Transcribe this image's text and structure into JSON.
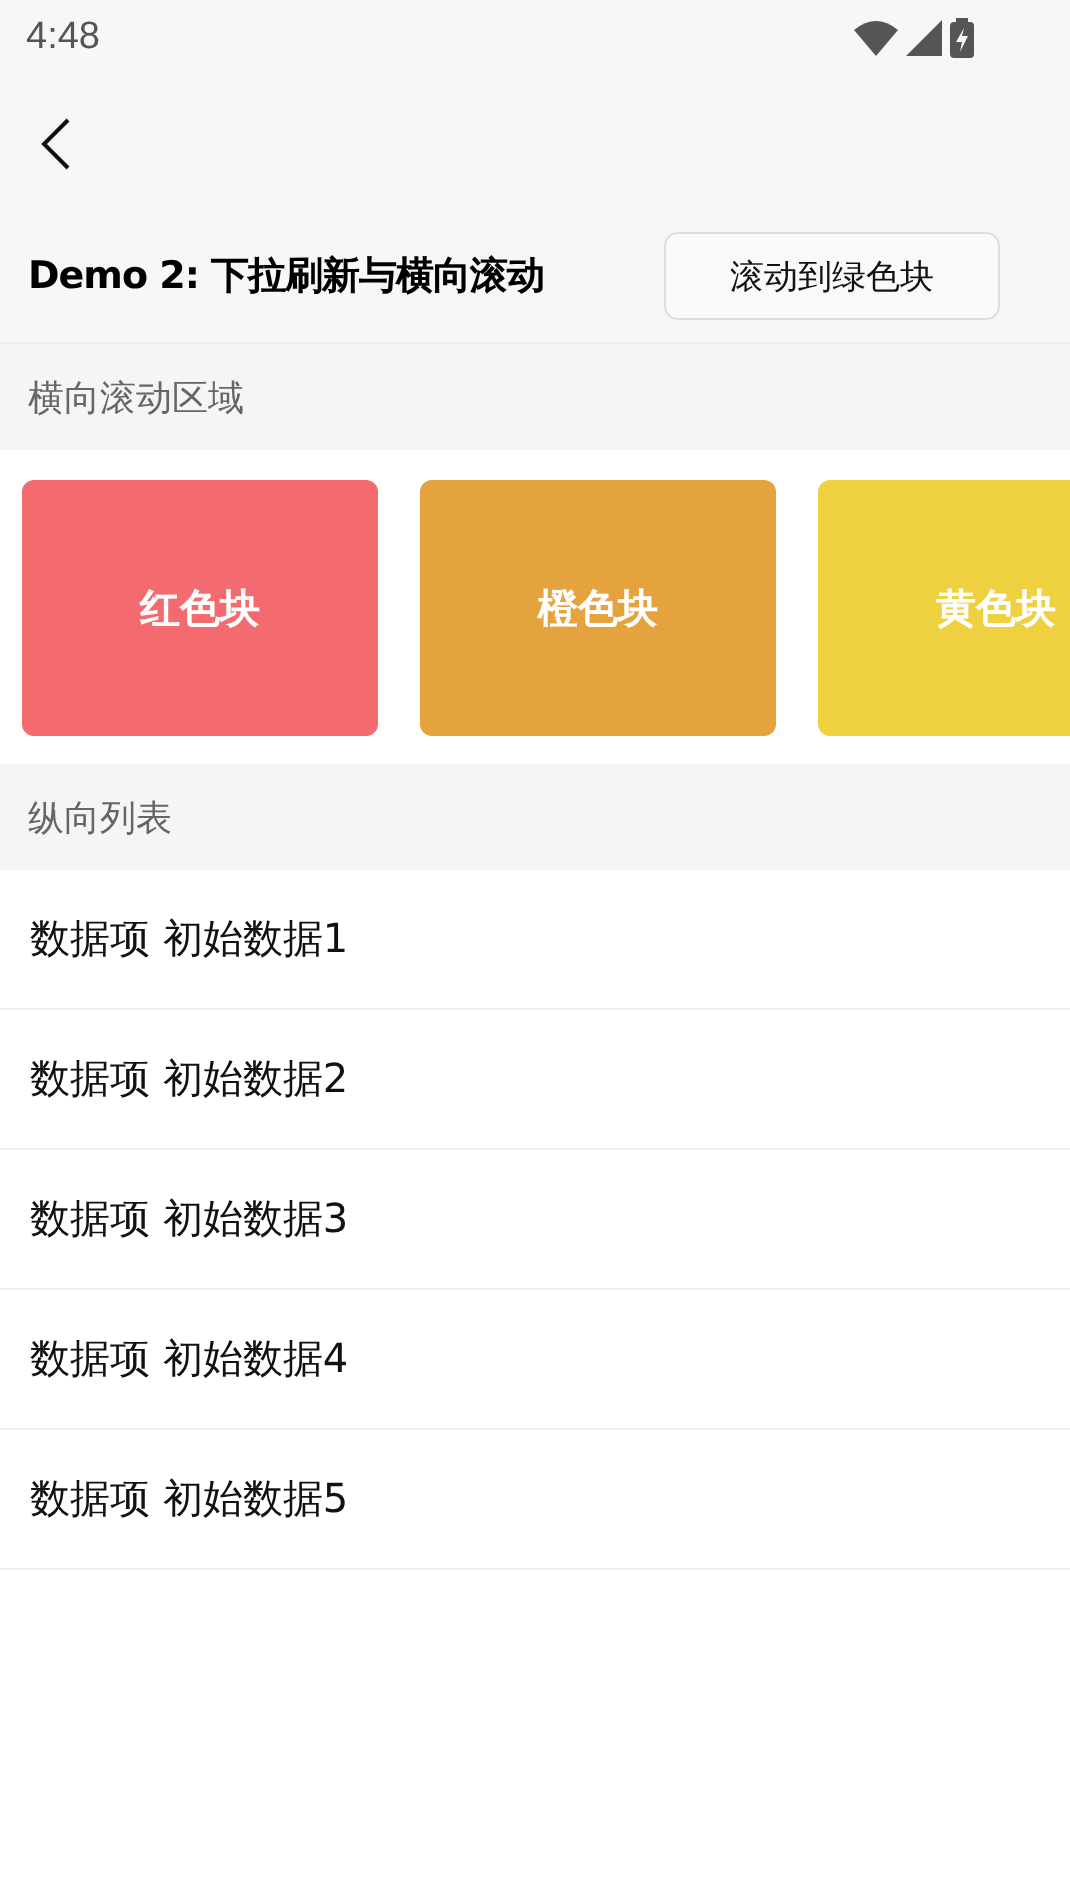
{
  "status_bar": {
    "time": "4:48"
  },
  "header": {
    "title": "Demo 2: 下拉刷新与横向滚动",
    "button": "滚动到绿色块"
  },
  "horizontal_section": {
    "title": "横向滚动区域",
    "cards": [
      {
        "label": "红色块",
        "color": "#f36b6e"
      },
      {
        "label": "橙色块",
        "color": "#e4a33d"
      },
      {
        "label": "黄色块",
        "color": "#efd13f"
      }
    ]
  },
  "vertical_section": {
    "title": "纵向列表",
    "items": [
      {
        "label": "数据项 初始数据1"
      },
      {
        "label": "数据项 初始数据2"
      },
      {
        "label": "数据项 初始数据3"
      },
      {
        "label": "数据项 初始数据4"
      },
      {
        "label": "数据项 初始数据5"
      }
    ]
  }
}
